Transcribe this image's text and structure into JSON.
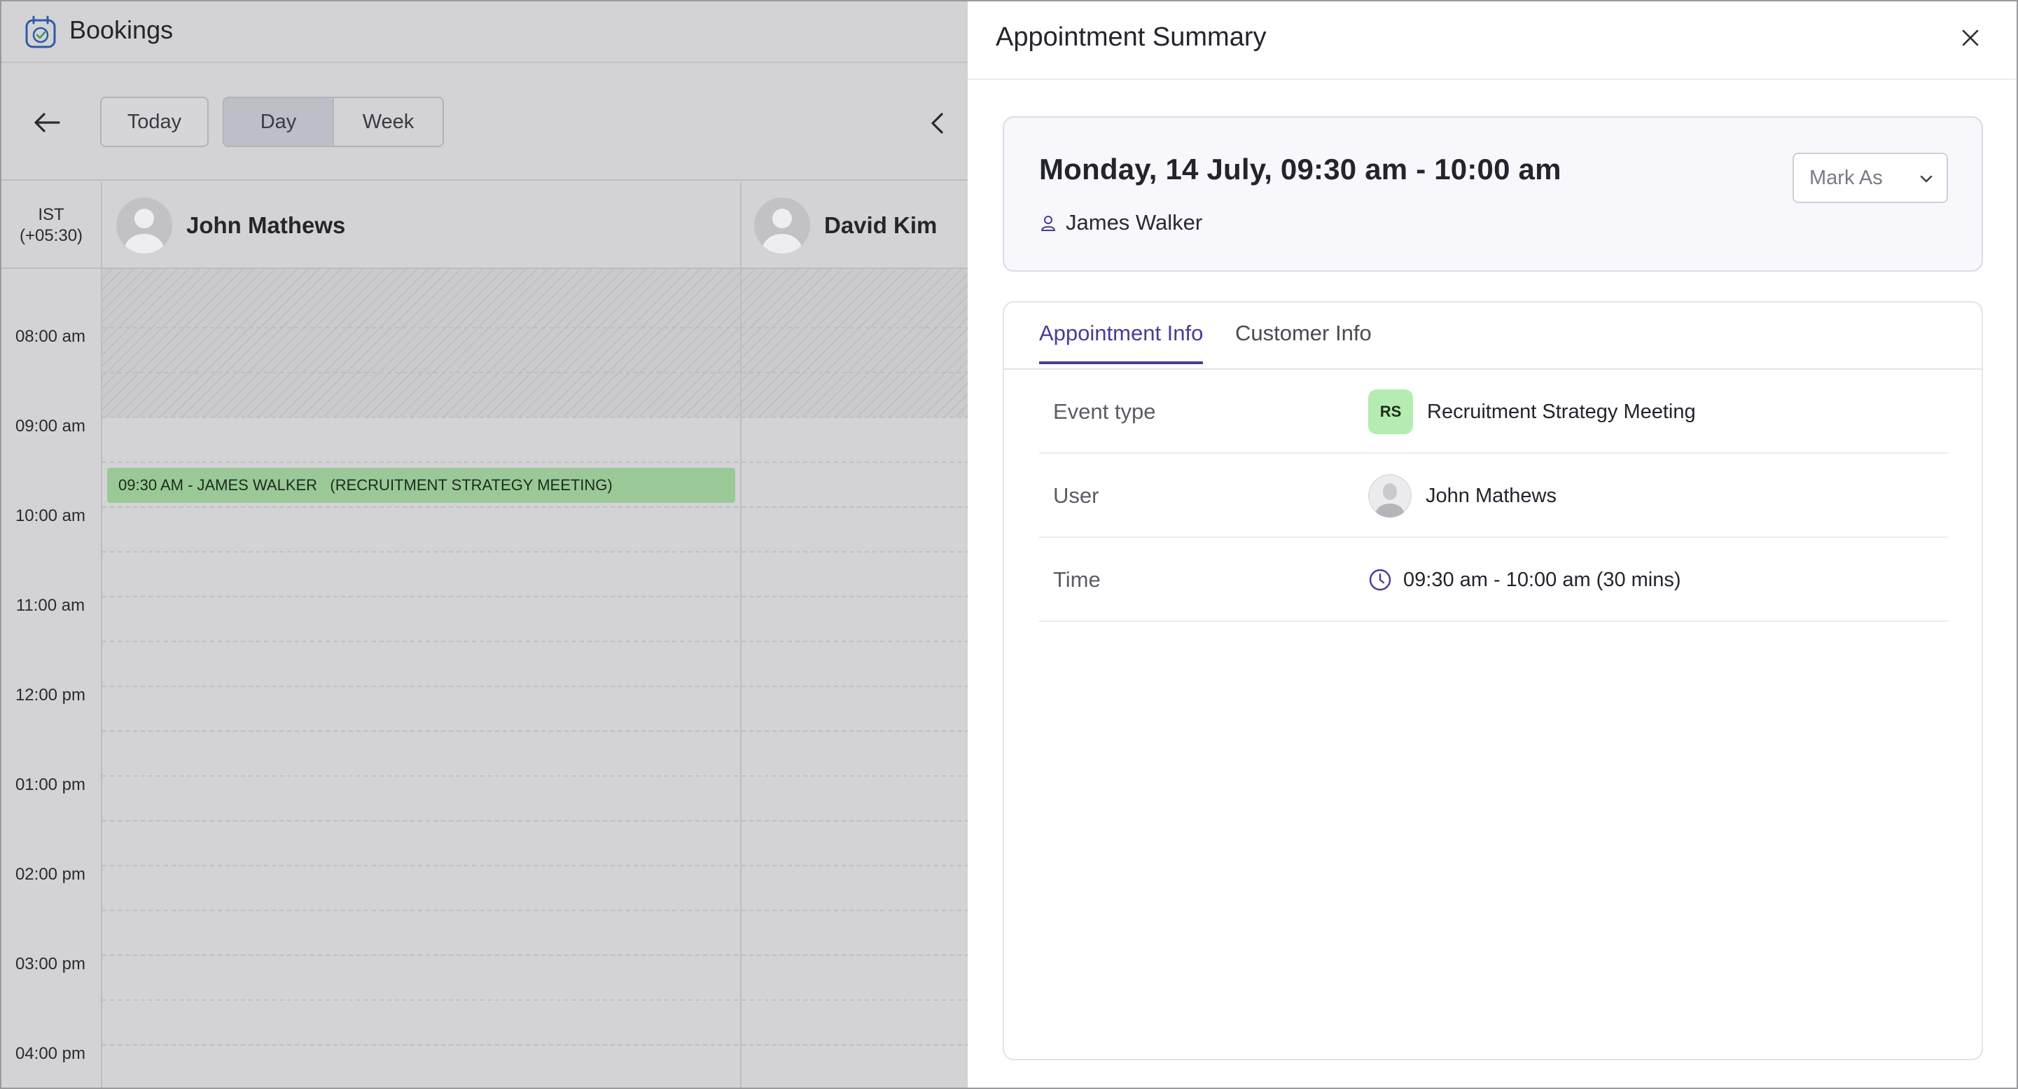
{
  "app": {
    "title": "Bookings",
    "logo_icon": "calendar-clock-icon",
    "accent": "#2f5ba8"
  },
  "toolbar": {
    "back_icon": "arrow-left-icon",
    "today_label": "Today",
    "views": [
      "Day",
      "Week"
    ],
    "active_view": "Day",
    "prev_icon": "chevron-left-icon"
  },
  "calendar": {
    "timezone": {
      "line1": "IST",
      "line2": "(+05:30)"
    },
    "resources": [
      "John Mathews",
      "David Kim"
    ],
    "time_labels": [
      "08:00 am",
      "09:00 am",
      "10:00 am",
      "11:00 am",
      "12:00 pm",
      "01:00 pm",
      "02:00 pm",
      "03:00 pm",
      "04:00 pm"
    ],
    "event": {
      "text": "09:30 AM - JAMES WALKER   (RECRUITMENT STRATEGY MEETING)",
      "color": "#9bc897"
    }
  },
  "panel": {
    "title": "Appointment Summary",
    "close_icon": "close-icon",
    "summary": {
      "datetime": "Monday, 14 July, 09:30 am - 10:00 am",
      "customer": "James Walker",
      "mark_as_placeholder": "Mark As"
    },
    "tabs": [
      "Appointment Info",
      "Customer Info"
    ],
    "active_tab": "Appointment Info",
    "tab_accent": "#4b3b98",
    "rows": {
      "event_type": {
        "label": "Event type",
        "badge": "RS",
        "value": "Recruitment Strategy Meeting"
      },
      "user": {
        "label": "User",
        "value": "John Mathews"
      },
      "time": {
        "label": "Time",
        "value": "09:30 am - 10:00 am (30 mins)"
      }
    }
  }
}
